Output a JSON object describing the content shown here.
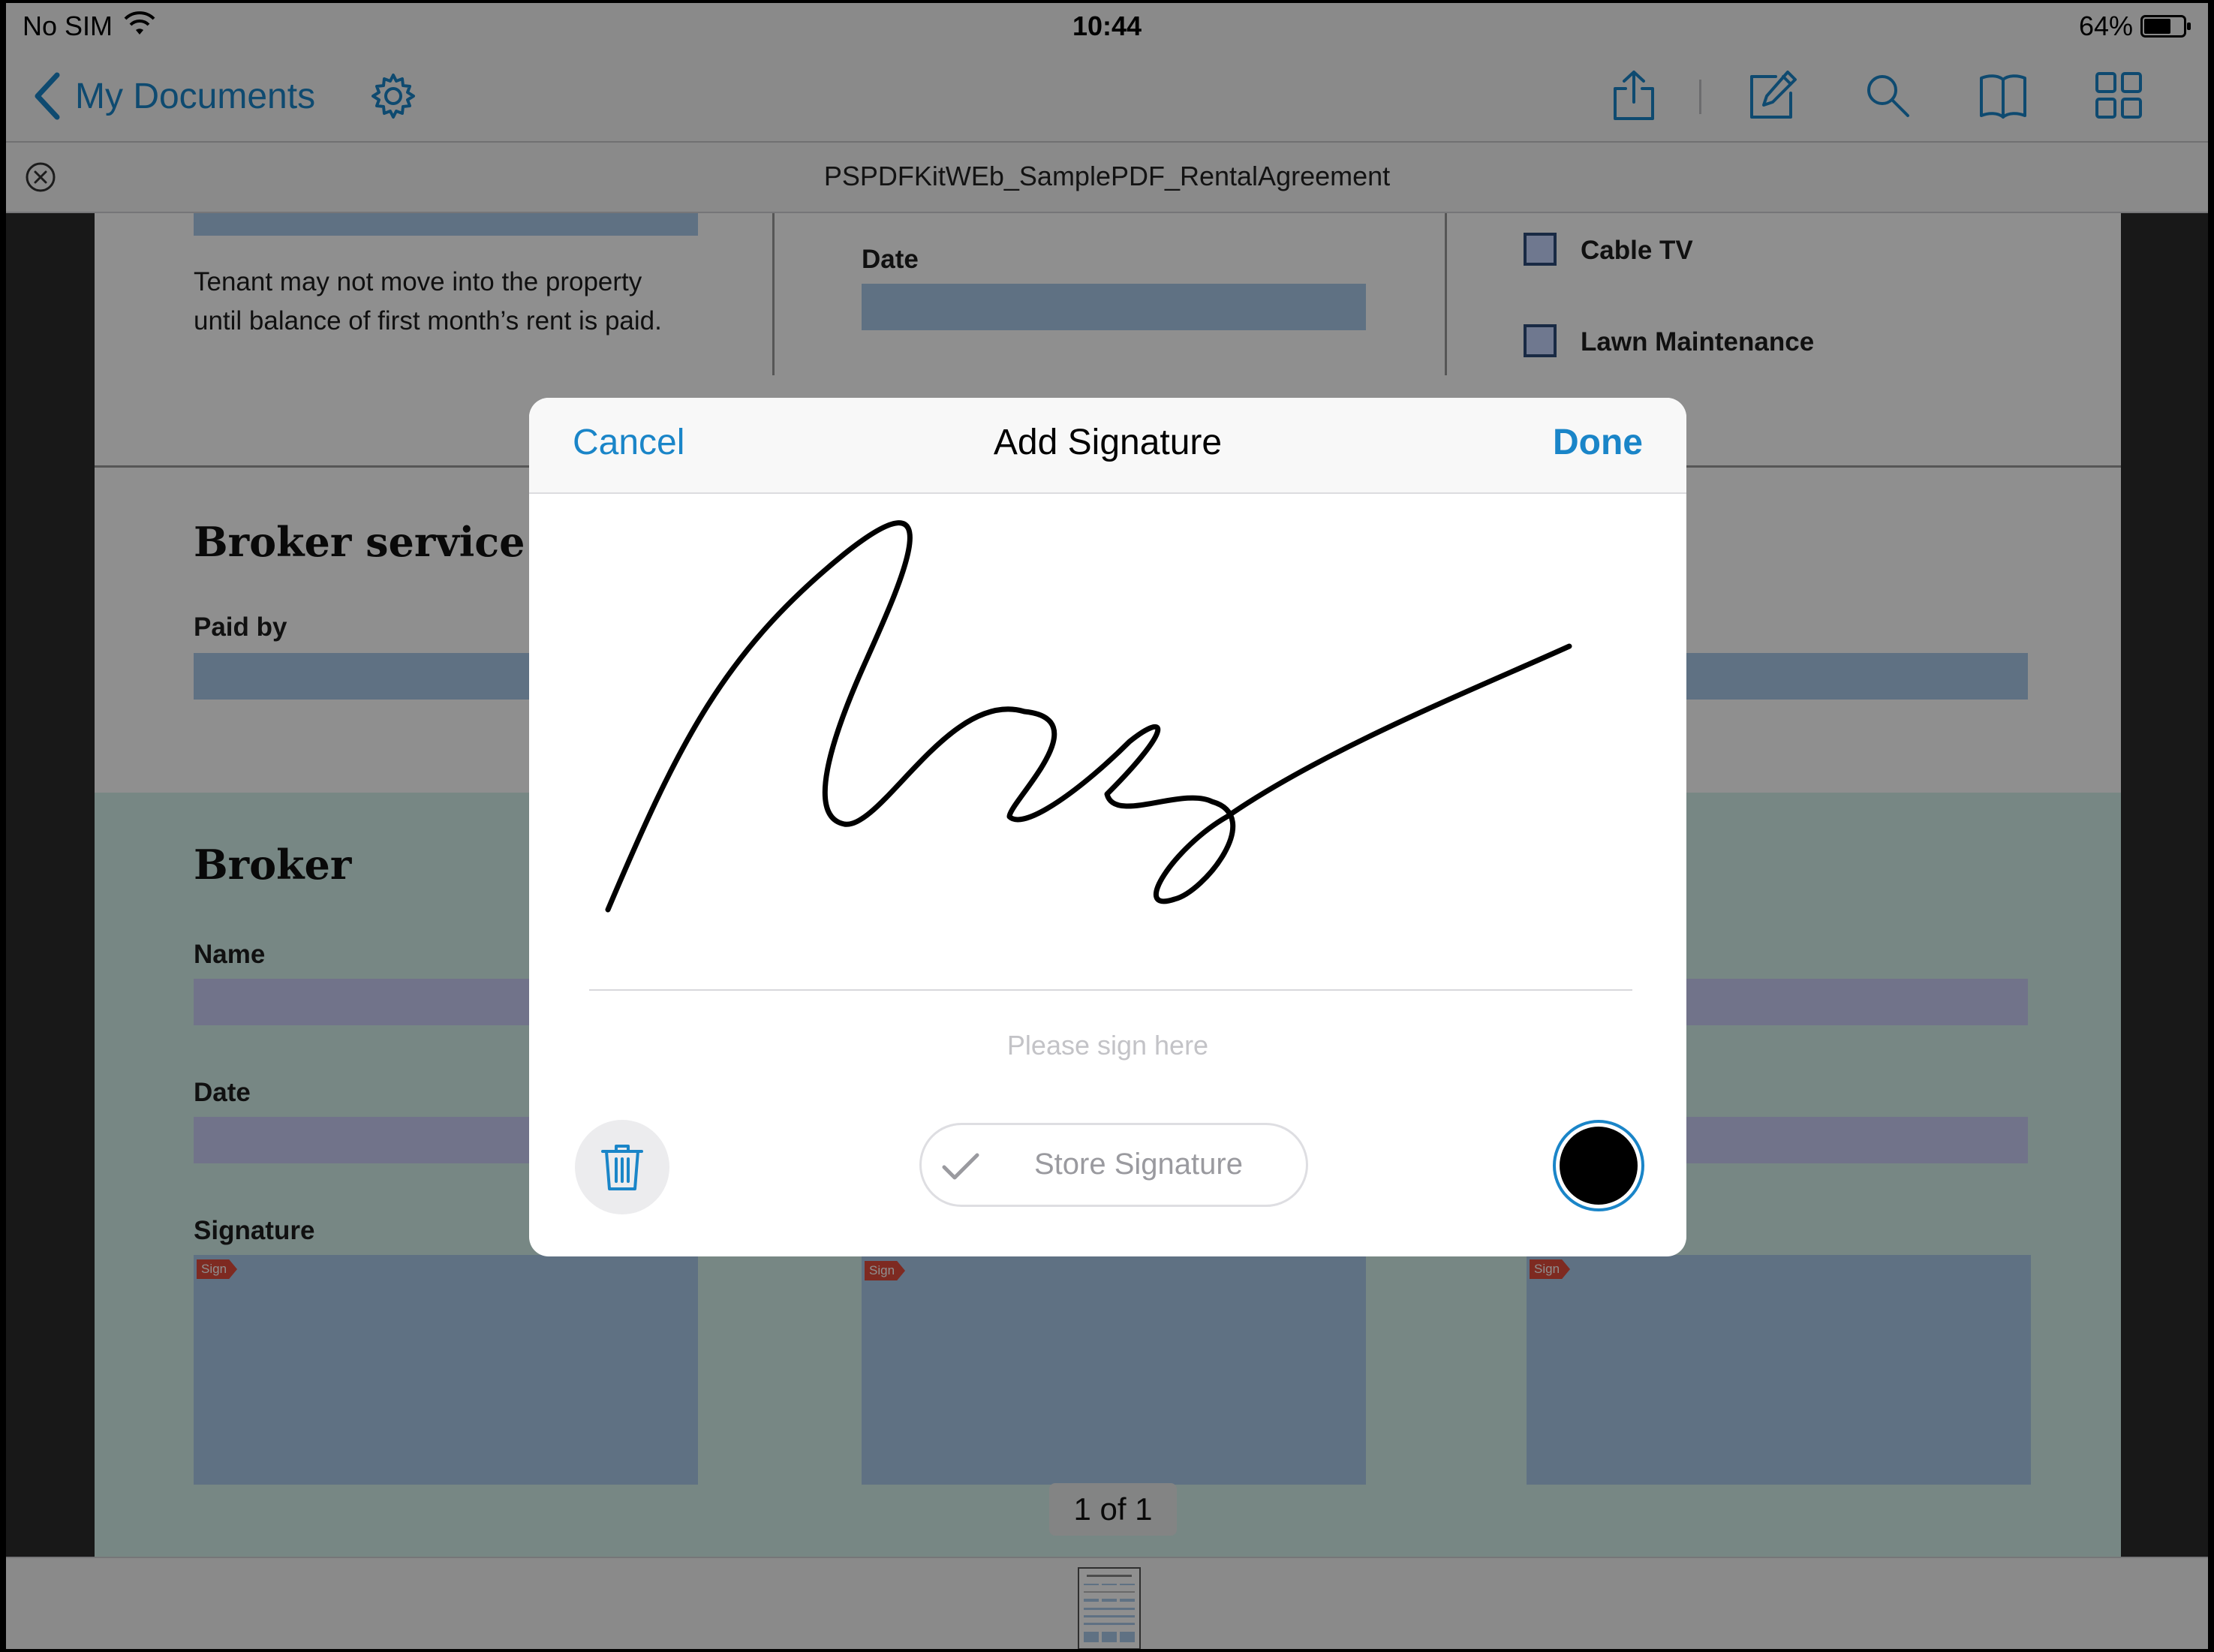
{
  "status_bar": {
    "carrier": "No SIM",
    "time": "10:44",
    "battery": "64%"
  },
  "nav": {
    "back_label": "My Documents",
    "icons": [
      "settings-gear-icon",
      "share-icon",
      "annotate-icon",
      "search-icon",
      "outline-book-icon",
      "thumbnail-grid-icon"
    ],
    "accent_color": "#1a85c8"
  },
  "document": {
    "title": "PSPDFKitWEb_SamplePDF_RentalAgreement",
    "tenant_note_line1": "Tenant may not move into the property",
    "tenant_note_line2": "until balance of first month’s rent is paid.",
    "date_label": "Date",
    "checkboxes": [
      {
        "label": "Cable TV"
      },
      {
        "label": "Lawn Maintenance"
      }
    ],
    "broker_service": {
      "heading": "Broker service",
      "paid_by_label": "Paid by"
    },
    "broker": {
      "heading": "Broker",
      "name_label": "Name",
      "date_label": "Date",
      "signature_label": "Signature",
      "sign_tag": "Sign"
    },
    "page_indicator": "1 of 1"
  },
  "signature_dialog": {
    "cancel_label": "Cancel",
    "title": "Add Signature",
    "done_label": "Done",
    "placeholder_hint": "Please sign here",
    "store_label": "Store Signature",
    "ink_color": "#000000"
  }
}
